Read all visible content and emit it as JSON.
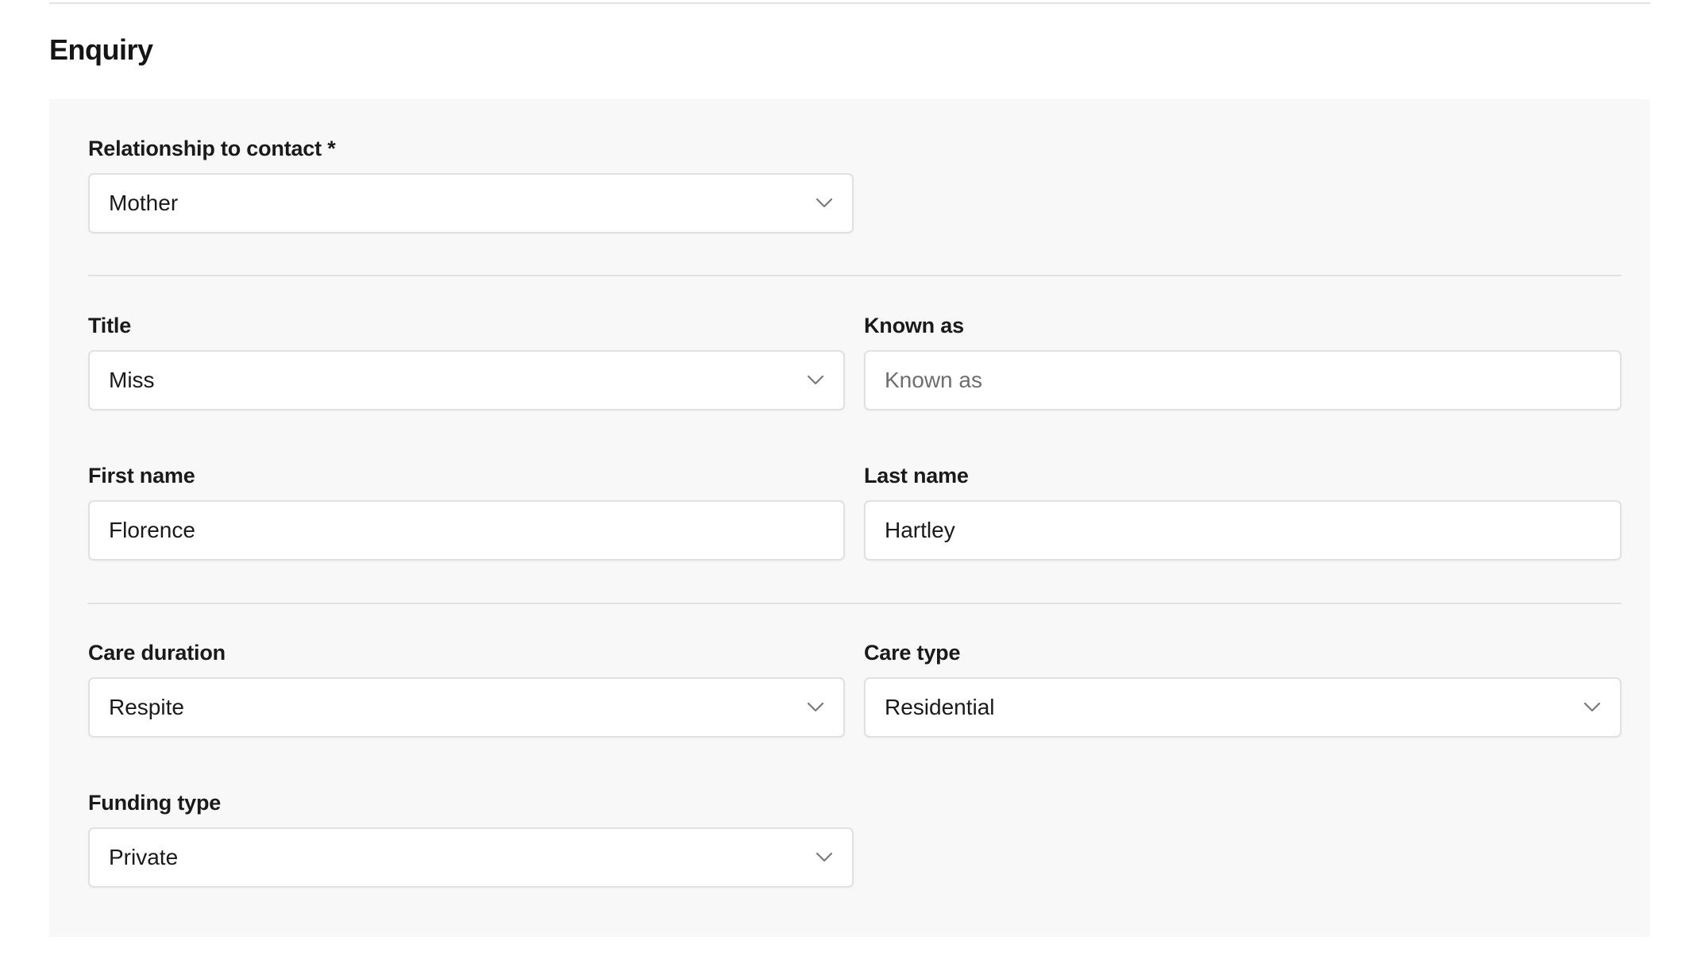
{
  "section": {
    "title": "Enquiry"
  },
  "relationship": {
    "label": "Relationship to contact *",
    "value": "Mother"
  },
  "title_field": {
    "label": "Title",
    "value": "Miss"
  },
  "known_as": {
    "label": "Known as",
    "value": "",
    "placeholder": "Known as"
  },
  "first_name": {
    "label": "First name",
    "value": "Florence"
  },
  "last_name": {
    "label": "Last name",
    "value": "Hartley"
  },
  "care_duration": {
    "label": "Care duration",
    "value": "Respite"
  },
  "care_type": {
    "label": "Care type",
    "value": "Residential"
  },
  "funding_type": {
    "label": "Funding type",
    "value": "Private"
  },
  "icons": {
    "select_chevron": "chevron-down-icon"
  },
  "colors": {
    "panel_background": "#f8f8f8",
    "control_border": "#e1e1e1",
    "divider": "#e2e2e2",
    "text": "#1a1a1a",
    "placeholder": "#6e6e6e"
  }
}
